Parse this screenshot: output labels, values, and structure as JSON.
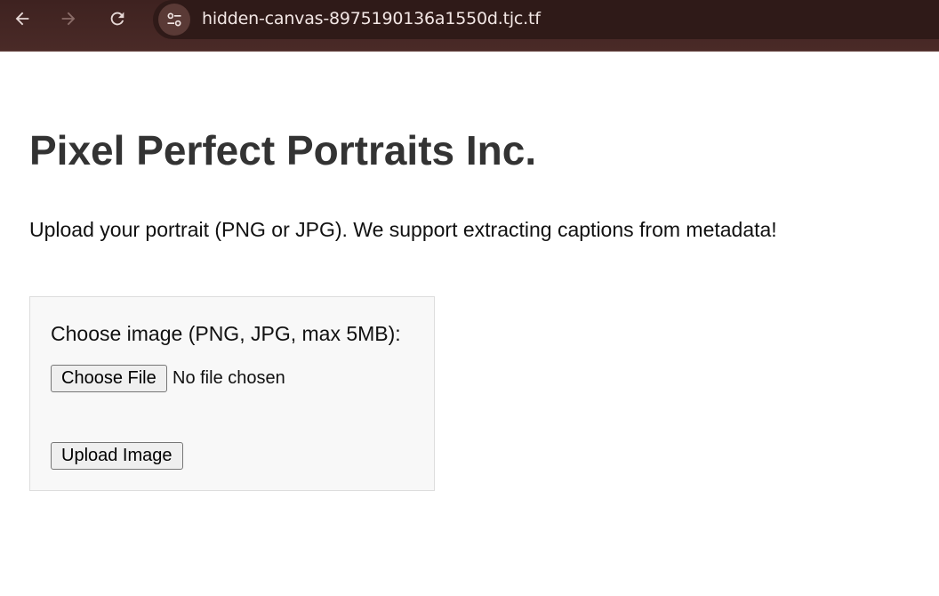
{
  "browser": {
    "url": "hidden-canvas-8975190136a1550d.tjc.tf",
    "back_icon": "arrow-left-icon",
    "forward_icon": "arrow-right-icon",
    "reload_icon": "reload-icon",
    "site_info_icon": "tune-icon",
    "colors": {
      "toolbar": "#3e2220",
      "omnibox": "#2f1a18",
      "text": "#f2e6e4"
    }
  },
  "page": {
    "title": "Pixel Perfect Portraits Inc.",
    "description": "Upload your portrait (PNG or JPG). We support extracting captions from metadata!",
    "form": {
      "label": "Choose image (PNG, JPG, max 5MB):",
      "file_button_label": "Choose File",
      "file_status": "No file chosen",
      "submit_label": "Upload Image"
    }
  }
}
